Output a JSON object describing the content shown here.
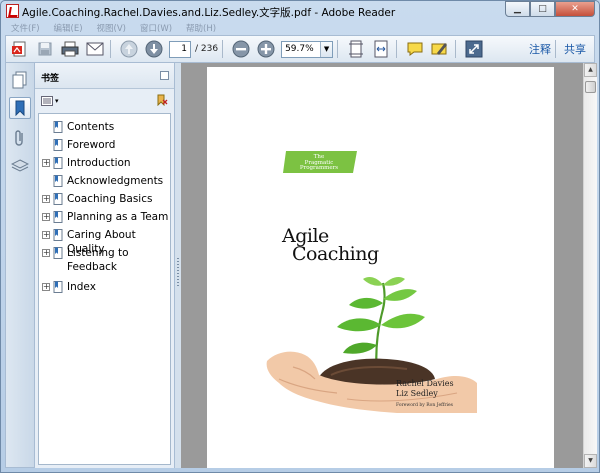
{
  "window": {
    "title": "Agile.Coaching.Rachel.Davies.and.Liz.Sedley.文字版.pdf - Adobe Reader",
    "controls": {
      "minimize": "▁",
      "maximize": "□",
      "close": "✕"
    }
  },
  "menubar": {
    "items": [
      "文件(F)",
      "编辑(E)",
      "视图(V)",
      "窗口(W)",
      "帮助(H)"
    ]
  },
  "toolbar": {
    "current_page": "1",
    "total_pages": "/ 236",
    "zoom": "59.7%",
    "zoom_dropdown": "▼",
    "comment_link": "注释",
    "share_link": "共享",
    "icons": [
      "create-pdf-icon",
      "save-icon",
      "print-icon",
      "email-icon",
      "previous-page-icon",
      "next-page-icon",
      "zoom-out-icon",
      "zoom-in-icon",
      "fit-page-icon",
      "fit-width-icon",
      "comment-icon",
      "highlight-icon",
      "full-screen-icon"
    ]
  },
  "leftstrip": {
    "icons": [
      "pages-icon",
      "bookmarks-icon",
      "attachments-icon",
      "layers-icon"
    ]
  },
  "bookmarks": {
    "title": "书签",
    "options_marker": "▾",
    "items": [
      {
        "label": "Contents",
        "expandable": false
      },
      {
        "label": "Foreword",
        "expandable": false
      },
      {
        "label": "Introduction",
        "expandable": true
      },
      {
        "label": "Acknowledgments",
        "expandable": false
      },
      {
        "label": "Coaching Basics",
        "expandable": true
      },
      {
        "label": "Planning as a Team",
        "expandable": true
      },
      {
        "label": "Caring About Quality",
        "expandable": true
      },
      {
        "label": "Listening to Feedback",
        "expandable": true
      },
      {
        "label": "Index",
        "expandable": true
      }
    ]
  },
  "document": {
    "badge_line1": "The",
    "badge_line2": "Pragmatic",
    "badge_line3": "Programmers",
    "title_line1": "Agile",
    "title_line2": "Coaching",
    "author1": "Rachel Davies",
    "author2": "Liz Sedley",
    "foreword": "Foreword by Ron Jeffries",
    "colors": {
      "badge_green": "#7cc242",
      "leaf_green": "#5bb832",
      "soil": "#4a3426",
      "skin": "#f2c9a8"
    }
  },
  "scrollbar": {
    "up": "▲",
    "down": "▼"
  }
}
